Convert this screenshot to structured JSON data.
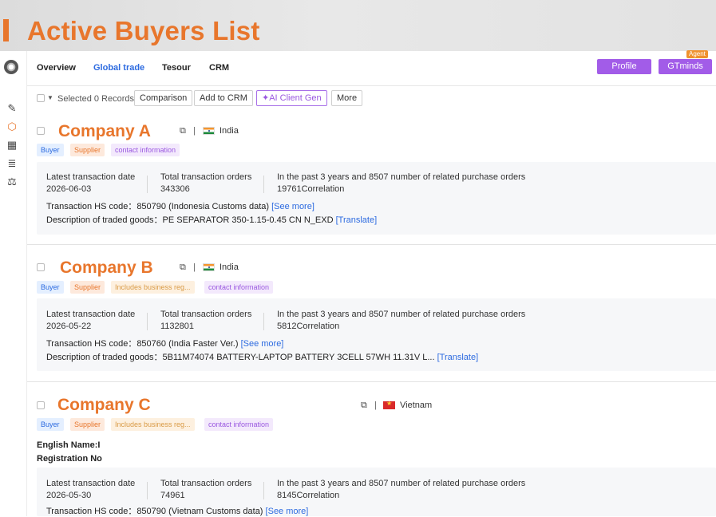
{
  "banner": {
    "title": "Active Buyers List"
  },
  "sidebar": {
    "icons": [
      "logo-icon",
      "magic-wand-icon",
      "cube-icon",
      "building-icon",
      "stats-icon",
      "scale-icon"
    ]
  },
  "nav": {
    "items": [
      "Overview",
      "Global trade",
      "Tesour",
      "CRM"
    ],
    "profile_label": "Profile",
    "gtminds_label": "GTminds",
    "agent_badge": "Agent"
  },
  "toolbar": {
    "selected_text": "Selected 0 Records",
    "comparison_label": "Comparison",
    "add_crm_label": "Add to CRM",
    "ai_label": "AI Client Gen",
    "more_label": "More"
  },
  "labels": {
    "latest_date": "Latest transaction date",
    "total_orders": "Total transaction orders",
    "related": "In the past 3 years and 8507 number of related purchase orders",
    "hs_prefix": "Transaction HS code：",
    "desc_prefix": "Description of traded goods：",
    "see_more": "[See more]",
    "translate": "[Translate]",
    "sep": "|"
  },
  "companies": [
    {
      "name": "Company A",
      "country": "India",
      "tags": [
        "Buyer",
        "Supplier",
        "contact information"
      ],
      "date": "2026-06-03",
      "orders": "343306",
      "correlation": "19761Correlation",
      "hs": "850790  (Indonesia Customs data)",
      "desc": "PE SEPARATOR 350-1.15-0.45 CN N_EXD"
    },
    {
      "name": "Company B",
      "country": "India",
      "tags": [
        "Buyer",
        "Supplier",
        "Includes business reg...",
        "contact information"
      ],
      "date": "2026-05-22",
      "orders": "1132801",
      "correlation": "5812Correlation",
      "hs": "850760  (India Faster Ver.)",
      "desc": "5B11M74074 BATTERY-LAPTOP BATTERY 3CELL 57WH 11.31V L..."
    },
    {
      "name": "Company C",
      "country": "Vietnam",
      "tags": [
        "Buyer",
        "Supplier",
        "Includes business reg...",
        "contact information"
      ],
      "english_name": "English Name:I",
      "registration": "Registration No",
      "date": "2026-05-30",
      "orders": "74961",
      "correlation": "8145Correlation",
      "hs": "850790  (Vietnam Customs data)"
    }
  ]
}
